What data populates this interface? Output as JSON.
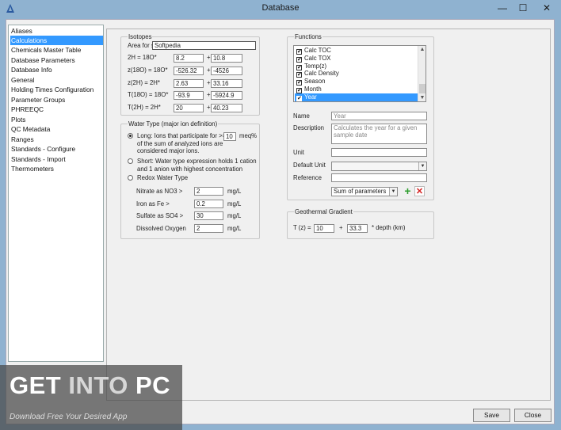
{
  "window": {
    "title": "Database",
    "minimize_glyph": "—",
    "maximize_glyph": "☐",
    "close_glyph": "✕",
    "icon": "app-triangle-icon"
  },
  "sidebar": {
    "items": [
      {
        "label": "Aliases",
        "selected": false
      },
      {
        "label": "Calculations",
        "selected": true
      },
      {
        "label": "Chemicals Master Table",
        "selected": false
      },
      {
        "label": "Database Parameters",
        "selected": false
      },
      {
        "label": "Database Info",
        "selected": false
      },
      {
        "label": "General",
        "selected": false
      },
      {
        "label": "Holding Times Configuration",
        "selected": false
      },
      {
        "label": "Parameter Groups",
        "selected": false
      },
      {
        "label": "PHREEQC",
        "selected": false
      },
      {
        "label": "Plots",
        "selected": false
      },
      {
        "label": "QC Metadata",
        "selected": false
      },
      {
        "label": "Ranges",
        "selected": false
      },
      {
        "label": "Standards - Configure",
        "selected": false
      },
      {
        "label": "Standards - Import",
        "selected": false
      },
      {
        "label": "Thermometers",
        "selected": false
      }
    ]
  },
  "isotopes": {
    "legend": "Isotopes",
    "area_label": "Area for st",
    "area_value": "Softpedia",
    "rows": [
      {
        "label": "2H      = 18O*",
        "a": "8.2",
        "plus": "+",
        "b": "10.8"
      },
      {
        "label": "z(18O) = 18O*",
        "a": "-526.32",
        "plus": "+",
        "b": "-4526"
      },
      {
        "label": "z(2H)   =  2H*",
        "a": "2.63",
        "plus": "+",
        "b": "33.16"
      },
      {
        "label": "T(18O) = 18O*",
        "a": "-93.9",
        "plus": "+",
        "b": "-5924.9"
      },
      {
        "label": "T(2H)   =  2H*",
        "a": "20",
        "plus": "+",
        "b": "40.23"
      }
    ]
  },
  "water_type": {
    "legend": "Water Type (major ion definition)",
    "long_text_1": "Long: Ions that participate for >=",
    "long_value": "10",
    "long_unit": "meq%",
    "long_text_2": "of the sum of analyzed ions are",
    "long_text_3": "considered major ions.",
    "short_text_1": "Short: Water type expression holds 1 cation",
    "short_text_2": "and 1 anion with highest concentration",
    "redox_text": "Redox Water Type",
    "selected": "long",
    "params": [
      {
        "label": "Nitrate as NO3 >",
        "value": "2",
        "unit": "mg/L"
      },
      {
        "label": "Iron as Fe >",
        "value": "0.2",
        "unit": "mg/L"
      },
      {
        "label": "Sulfate as SO4 >",
        "value": "30",
        "unit": "mg/L"
      },
      {
        "label": "Dissolved Oxygen",
        "value": "2",
        "unit": "mg/L"
      }
    ]
  },
  "functions": {
    "legend": "Functions",
    "items": [
      {
        "label": "Calc TOC",
        "checked": true,
        "selected": false
      },
      {
        "label": "Calc TOX",
        "checked": true,
        "selected": false
      },
      {
        "label": "Temp(z)",
        "checked": true,
        "selected": false
      },
      {
        "label": "Calc Density",
        "checked": true,
        "selected": false
      },
      {
        "label": "Season",
        "checked": true,
        "selected": false
      },
      {
        "label": "Month",
        "checked": true,
        "selected": false
      },
      {
        "label": "Year",
        "checked": true,
        "selected": true
      }
    ],
    "check_glyph": "✔",
    "scroll_up": "▲",
    "scroll_down": "▼",
    "name_label": "Name",
    "name_value": "Year",
    "description_label": "Description",
    "description_value": "Calculates the year for a given sample date",
    "unit_label": "Unit",
    "unit_value": "",
    "default_unit_label": "Default Unit",
    "default_unit_value": "",
    "reference_label": "Reference",
    "reference_value": "",
    "method_value": "Sum of parameters",
    "dropdown_glyph": "▼",
    "add_glyph": "+",
    "delete_glyph": "✕",
    "add_color": "#2e9e2e",
    "delete_color": "#d42020"
  },
  "geothermal": {
    "legend": "Geothermal Gradient",
    "t_label": "T (z) =",
    "a": "10",
    "plus": "+",
    "b": "33.3",
    "suffix": "* depth (km)"
  },
  "buttons": {
    "save": "Save",
    "close": "Close"
  },
  "watermark": {
    "get": "GET ",
    "into": "INTO",
    "pc": " PC",
    "tagline": "Download Free Your Desired App"
  }
}
